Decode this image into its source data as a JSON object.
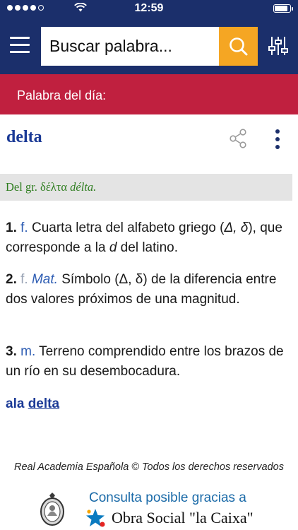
{
  "status_bar": {
    "time": "12:59",
    "signal_bars_filled": 4,
    "signal_bars_total": 5,
    "battery_level": 0.85
  },
  "header": {
    "search_placeholder": "Buscar palabra..."
  },
  "word_of_day": {
    "label": "Palabra del día:"
  },
  "entry": {
    "headword": "delta",
    "etymology": {
      "prefix": "Del gr. ",
      "greek": "δέλτα ",
      "translit": "délta."
    },
    "senses": [
      {
        "num": "1.",
        "abbr": "f.",
        "text_a": " Cuarta letra del alfabeto griego (",
        "text_b": "Δ, δ",
        "text_c": "), que corresponde a la ",
        "text_d": "d",
        "text_e": " del latino."
      },
      {
        "num": "2.",
        "abbr": "f.",
        "field": "Mat.",
        "text": " Símbolo (Δ, δ) de la diferencia entre dos valores próximos de una magnitud."
      },
      {
        "num": "3.",
        "abbr": "m.",
        "text": " Terreno comprendido entre los brazos de un río en su desembocadura."
      }
    ],
    "phrase": {
      "prefix": "ala ",
      "link": "delta"
    }
  },
  "footer": {
    "copyright": "Real Academia Española © Todos los derechos reservados",
    "sponsor_line1": "Consulta posible gracias a",
    "sponsor_line2": "Obra Social \"la Caixa\""
  },
  "icons": {
    "menu": "hamburger-icon",
    "search": "magnifier-icon",
    "filter": "sliders-icon",
    "share": "share-icon",
    "more": "vertical-dots-icon",
    "rae": "rae-crest-logo",
    "caixa": "caixa-star-logo"
  },
  "colors": {
    "header_bg": "#1b2f6b",
    "search_button": "#f5a623",
    "wotd_bar": "#c0203f",
    "headword": "#1b3a96",
    "etymology": "#2e7d1f",
    "abbreviation": "#2e5db3",
    "sponsor_text": "#1a6aa8"
  }
}
